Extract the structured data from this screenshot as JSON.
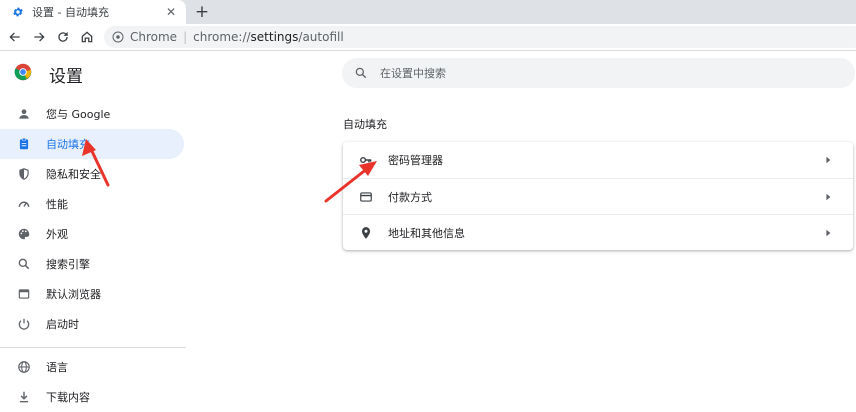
{
  "colors": {
    "accent": "#1a73e8",
    "annotation": "#e8342b",
    "active_bg": "#e8f0fe"
  },
  "tab": {
    "title": "设置 - 自动填充",
    "icon": "gear-icon",
    "close": "✕"
  },
  "new_tab": "+",
  "omnibox": {
    "label": "Chrome",
    "separator": "|",
    "url_prefix": "chrome://",
    "url_bold": "settings",
    "url_suffix": "/autofill"
  },
  "header": {
    "title": "设置"
  },
  "search": {
    "placeholder": "在设置中搜索"
  },
  "sidebar": {
    "items": [
      {
        "label": "您与 Google",
        "icon": "person-icon"
      },
      {
        "label": "自动填充",
        "icon": "clipboard-icon",
        "active": true
      },
      {
        "label": "隐私和安全",
        "icon": "shield-icon"
      },
      {
        "label": "性能",
        "icon": "speedometer-icon"
      },
      {
        "label": "外观",
        "icon": "palette-icon"
      },
      {
        "label": "搜索引擎",
        "icon": "search-icon"
      },
      {
        "label": "默认浏览器",
        "icon": "browser-icon"
      },
      {
        "label": "启动时",
        "icon": "power-icon"
      },
      {
        "label": "语言",
        "icon": "globe-icon"
      },
      {
        "label": "下载内容",
        "icon": "download-icon"
      }
    ]
  },
  "main": {
    "section_title": "自动填充",
    "rows": [
      {
        "label": "密码管理器",
        "icon": "key-icon"
      },
      {
        "label": "付款方式",
        "icon": "credit-card-icon"
      },
      {
        "label": "地址和其他信息",
        "icon": "location-pin-icon"
      }
    ]
  }
}
